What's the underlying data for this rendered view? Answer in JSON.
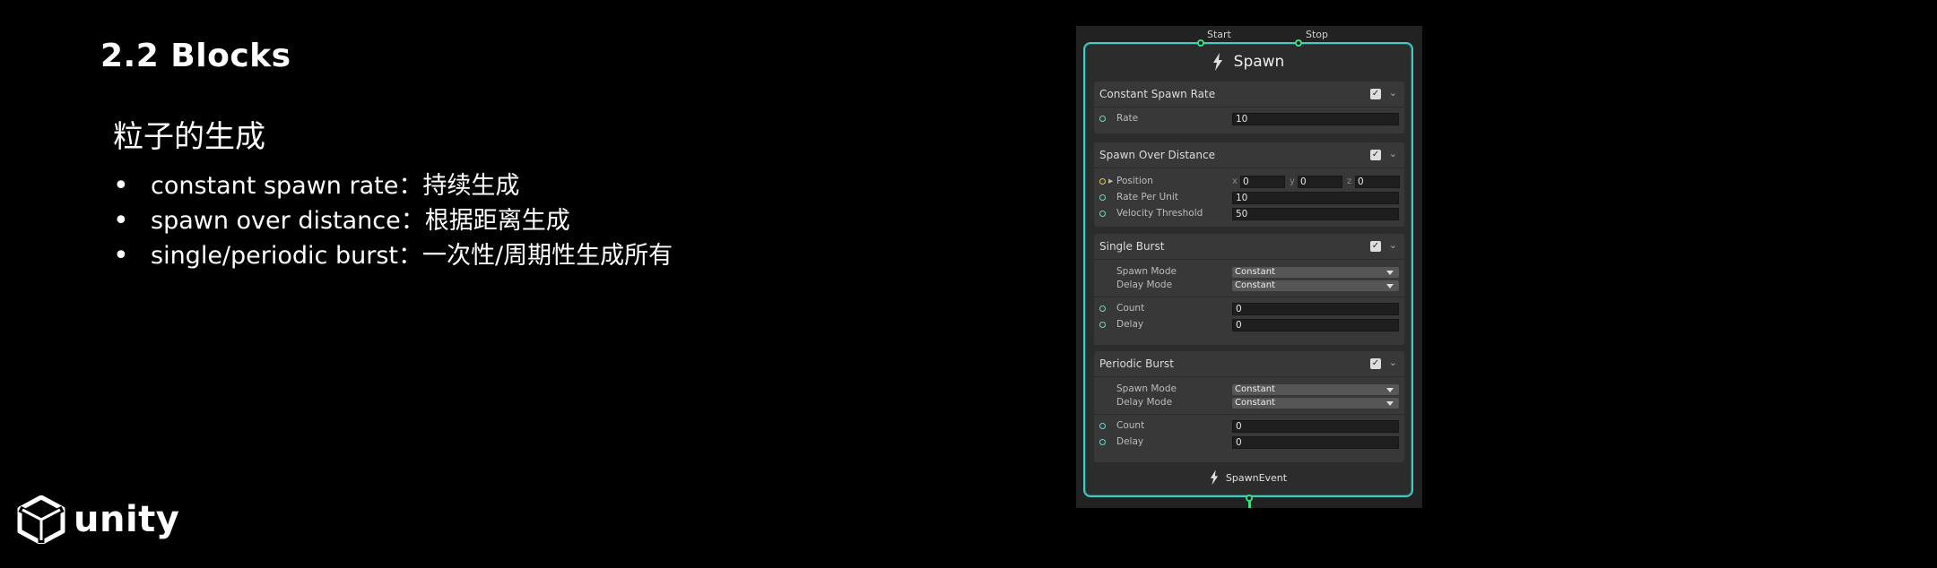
{
  "slide": {
    "title": "2.2 Blocks",
    "subtitle": "粒子的生成",
    "bullets": [
      "constant spawn rate：持续生成",
      "spawn over distance：根据距离生成",
      "single/periodic burst：一次性/周期性生成所有"
    ]
  },
  "logo": {
    "text": "unity",
    "icon": "unity-logo-icon"
  },
  "node": {
    "title": "Spawn",
    "input_ports": {
      "start": "Start",
      "stop": "Stop"
    },
    "output_label": "SpawnEvent",
    "accent_color": "#47c9c0",
    "flow_port_color": "#3ddc84",
    "blocks": {
      "constant": {
        "title": "Constant Spawn Rate",
        "rate_label": "Rate",
        "rate_value": "10"
      },
      "distance": {
        "title": "Spawn Over Distance",
        "position_label": "Position",
        "position": {
          "x_label": "x",
          "x": "0",
          "y_label": "y",
          "y": "0",
          "z_label": "z",
          "z": "0"
        },
        "rate_per_unit_label": "Rate Per Unit",
        "rate_per_unit": "10",
        "velocity_threshold_label": "Velocity Threshold",
        "velocity_threshold": "50"
      },
      "single": {
        "title": "Single Burst",
        "spawn_mode_label": "Spawn Mode",
        "spawn_mode": "Constant",
        "delay_mode_label": "Delay Mode",
        "delay_mode": "Constant",
        "count_label": "Count",
        "count": "0",
        "delay_label": "Delay",
        "delay": "0"
      },
      "periodic": {
        "title": "Periodic Burst",
        "spawn_mode_label": "Spawn Mode",
        "spawn_mode": "Constant",
        "delay_mode_label": "Delay Mode",
        "delay_mode": "Constant",
        "count_label": "Count",
        "count": "0",
        "delay_label": "Delay",
        "delay": "0"
      }
    }
  }
}
